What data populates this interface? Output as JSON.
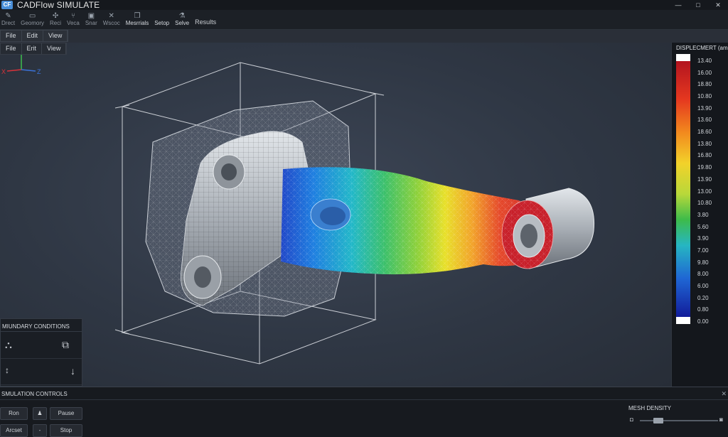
{
  "app": {
    "title": "CADFlow SIMULATE",
    "logo_text": "CF"
  },
  "window_controls": {
    "minimize": "—",
    "maximize": "□",
    "close": "✕"
  },
  "toolbar": {
    "tools": [
      {
        "label": "Drect",
        "icon": "pencil-icon"
      },
      {
        "label": "Geomory",
        "icon": "folder-icon"
      },
      {
        "label": "Reci",
        "icon": "grid-icon"
      },
      {
        "label": "Veca",
        "icon": "fork-icon"
      },
      {
        "label": "Snar",
        "icon": "box-icon"
      },
      {
        "label": "Wscoc",
        "icon": "wrench-icon"
      },
      {
        "label": "Mesrrials",
        "icon": "cube-icon"
      },
      {
        "label": "Setop",
        "icon": "cube-icon"
      },
      {
        "label": "Selve",
        "icon": "flask-icon"
      },
      {
        "label": "Results",
        "icon": ""
      }
    ]
  },
  "menu": [
    "File",
    "Edit",
    "View"
  ],
  "menu_secondary": [
    "File",
    "Erit",
    "View"
  ],
  "axis_triad": {
    "y": "Y",
    "x": "X",
    "z": "Z"
  },
  "legend": {
    "title": "DISPLECMERT (amm)",
    "labels": [
      "13.40",
      "16.00",
      "18.80",
      "10.80",
      "13.90",
      "13.60",
      "18.60",
      "13.80",
      "16.80",
      "19.80",
      "13.90",
      "13.00",
      "10.80",
      "3.80",
      "5.60",
      "3.90",
      "7.00",
      "9.80",
      "8.00",
      "6.00",
      "0.20",
      "0.80",
      "0.00"
    ]
  },
  "boundary_conditions": {
    "title": "MIUNDARY CONDITIONS"
  },
  "simulation_controls": {
    "title": "SMULATION CONTROLS",
    "run": "Ron",
    "pause": "Pause",
    "reset": "Arcset",
    "stop": "Stop"
  },
  "mesh_density": {
    "title": "MESH DENSITY",
    "value": 0.2
  }
}
